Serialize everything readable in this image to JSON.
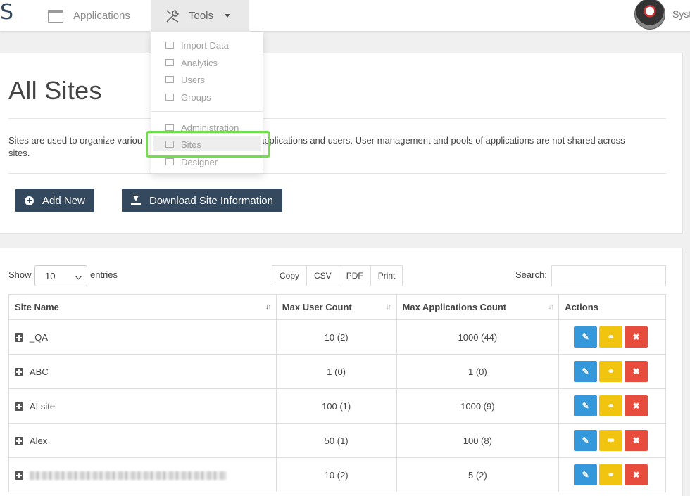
{
  "topbar": {
    "brand": "S",
    "nav_applications": "Applications",
    "nav_tools": "Tools",
    "user_name": "Syst"
  },
  "tools_menu": {
    "items": [
      {
        "label": "Import Data",
        "icon": "import-icon"
      },
      {
        "label": "Analytics",
        "icon": "chart-icon"
      },
      {
        "label": "Users",
        "icon": "user-icon"
      },
      {
        "label": "Groups",
        "icon": "group-icon"
      },
      {
        "label": "Administration",
        "icon": "monitor-icon"
      },
      {
        "label": "Sites",
        "icon": "map-icon"
      },
      {
        "label": "Designer",
        "icon": "designer-icon"
      }
    ],
    "selected": "Sites",
    "highlight_color": "#6ee04a"
  },
  "page": {
    "title": "All Sites",
    "description_a": "Sites are used to organize variou",
    "description_b": "applications and users. User management and pools of applications are not shared across",
    "description_c": "sites.",
    "add_new_label": "Add New",
    "download_label": "Download Site Information"
  },
  "table_controls": {
    "show_label": "Show",
    "page_size": "10",
    "entries_label": "entries",
    "export_buttons": [
      "Copy",
      "CSV",
      "PDF",
      "Print"
    ],
    "search_label": "Search:",
    "search_value": ""
  },
  "table": {
    "columns": [
      "Site Name",
      "Max User Count",
      "Max Applications Count",
      "Actions"
    ],
    "rows": [
      {
        "name": "_QA",
        "max_users": "10 (2)",
        "max_apps": "1000 (44)"
      },
      {
        "name": "ABC",
        "max_users": "1 (0)",
        "max_apps": "1 (0)"
      },
      {
        "name": "AI site",
        "max_users": "100 (1)",
        "max_apps": "1000 (9)"
      },
      {
        "name": "Alex",
        "max_users": "50 (1)",
        "max_apps": "100 (8)"
      },
      {
        "name": "",
        "max_users": "10 (2)",
        "max_apps": "5 (2)"
      }
    ]
  },
  "colors": {
    "primary_dark": "#34495e",
    "edit": "#3498db",
    "link": "#f1c40f",
    "delete": "#e74c3c"
  }
}
